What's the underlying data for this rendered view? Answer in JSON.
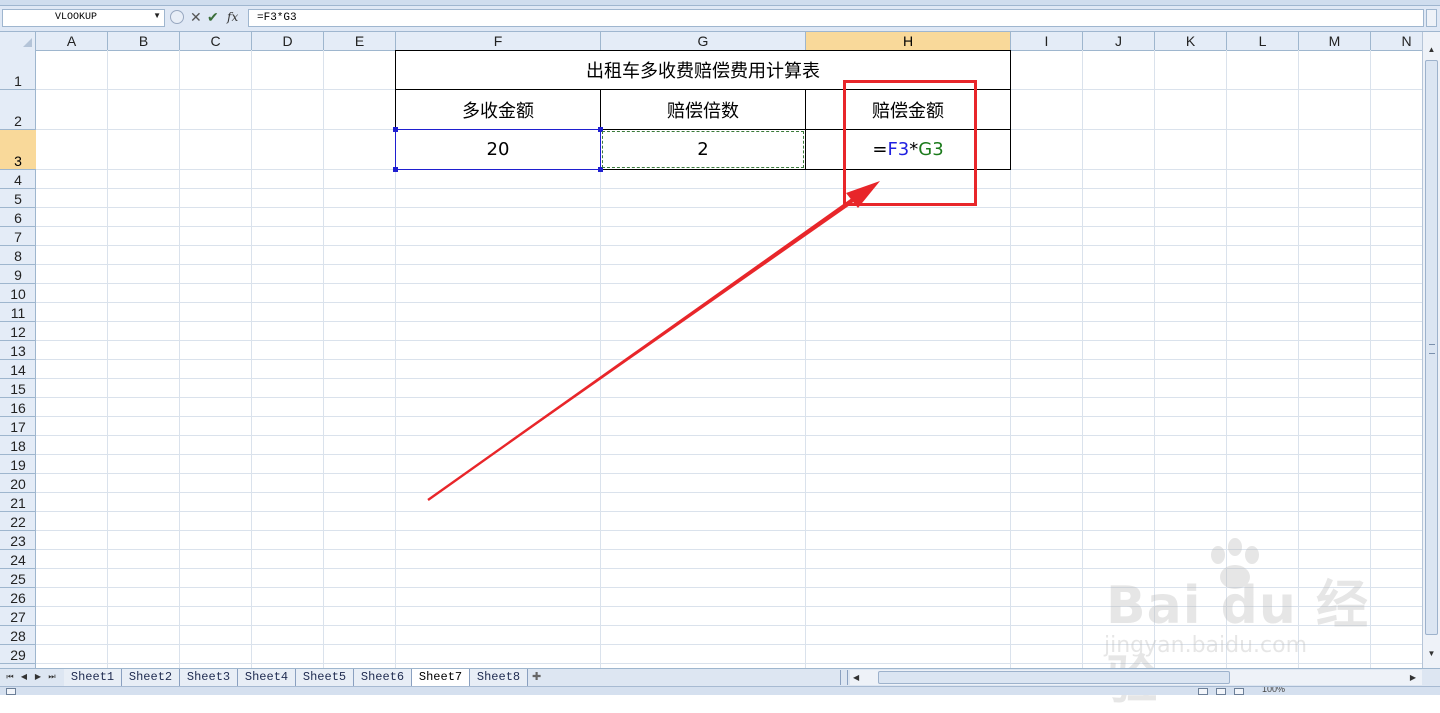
{
  "formula_bar": {
    "name_box": "VLOOKUP",
    "cancel_icon": "✕",
    "enter_icon": "✔",
    "fx_label": "fx",
    "formula": "=F3*G3"
  },
  "columns": [
    "A",
    "B",
    "C",
    "D",
    "E",
    "F",
    "G",
    "H",
    "I",
    "J",
    "K",
    "L",
    "M",
    "N"
  ],
  "active_column": "H",
  "rows": [
    "1",
    "2",
    "3",
    "4",
    "5",
    "6",
    "7",
    "8",
    "9",
    "10",
    "11",
    "12",
    "13",
    "14",
    "15",
    "16",
    "17",
    "18",
    "19",
    "20",
    "21",
    "22",
    "23",
    "24",
    "25",
    "26",
    "27",
    "28",
    "29"
  ],
  "active_row": "3",
  "table": {
    "title": "出租车多收费赔偿费用计算表",
    "headers": [
      "多收金额",
      "赔偿倍数",
      "赔偿金额"
    ],
    "values": {
      "f3": "20",
      "g3": "2",
      "h3_eq": "=",
      "h3_ref1": "F3",
      "h3_op": "*",
      "h3_ref2": "G3"
    }
  },
  "sheet_tabs": [
    "Sheet1",
    "Sheet2",
    "Sheet3",
    "Sheet4",
    "Sheet5",
    "Sheet6",
    "Sheet7",
    "Sheet8"
  ],
  "active_sheet": "Sheet7",
  "watermark": {
    "text": "Bai du 经验",
    "url": "jingyan.baidu.com"
  },
  "status": {
    "zoom": "100%"
  },
  "colors": {
    "annotation": "#e8262a",
    "ref_blue": "#1f1fe0",
    "ref_green": "#1b7a1b",
    "header_active": "#f9d99a"
  },
  "icons": {
    "cancel": "close-icon",
    "enter": "checkmark-icon",
    "fx": "function-icon",
    "annotation_arrow": "arrow-icon"
  }
}
